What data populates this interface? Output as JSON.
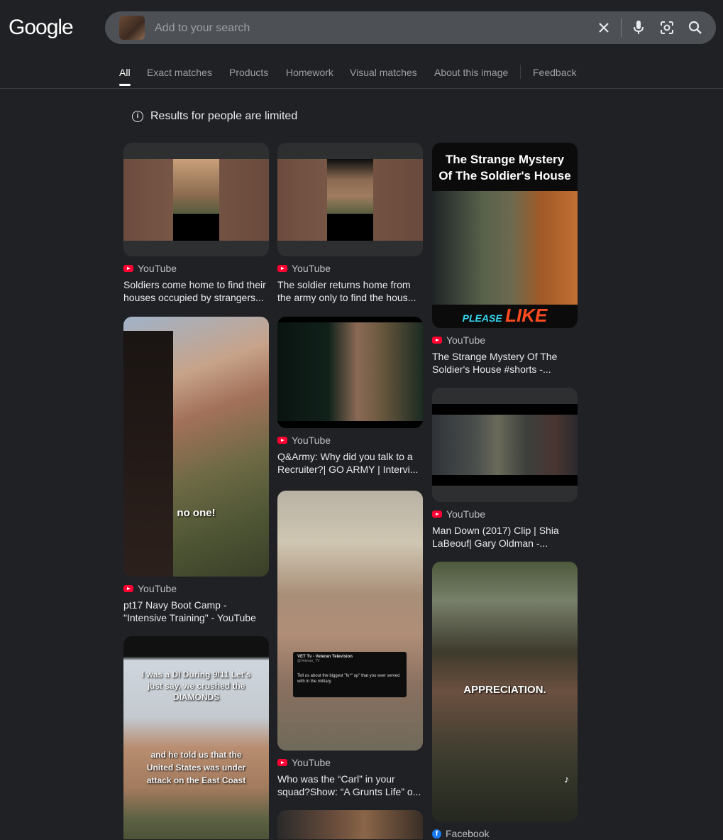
{
  "header": {
    "logo": "Google"
  },
  "search": {
    "placeholder": "Add to your search"
  },
  "tabs": [
    {
      "label": "All"
    },
    {
      "label": "Exact matches"
    },
    {
      "label": "Products"
    },
    {
      "label": "Homework"
    },
    {
      "label": "Visual matches"
    },
    {
      "label": "About this image"
    },
    {
      "label": "Feedback"
    }
  ],
  "notice": "Results for people are limited",
  "results": [
    {
      "source": "YouTube",
      "title": "Soldiers come home to find their houses occupied by strangers..."
    },
    {
      "source": "YouTube",
      "title": "The soldier returns home from the army only to find the hous..."
    },
    {
      "source": "YouTube",
      "title": "The Strange Mystery Of The Soldier's House #shorts -...",
      "overlay_top": "The Strange Mystery Of The Soldier's House",
      "overlay_bottom_a": "PLEASE",
      "overlay_bottom_b": "LIKE"
    },
    {
      "source": "YouTube",
      "title": "pt17 Navy Boot Camp - \"Intensive Training\" - YouTube",
      "overlay": "no one!"
    },
    {
      "source": "YouTube",
      "title": "Q&Army: Why did you talk to a Recruiter?| GO ARMY | Intervi..."
    },
    {
      "source": "YouTube",
      "title": "Man Down (2017) Clip | Shia LaBeouf| Gary Oldman -..."
    },
    {
      "source": "YouTube",
      "title": "Who was the “Carl” in your squad?Show: “A Grunts Life” o...",
      "overlay_head": "VET Tv - Veteran Television",
      "overlay_handle": "@Veteran_TV",
      "overlay_body": "Tell us about the biggest \"fu*\" up\" that you ever served with in the military."
    },
    {
      "source": "Facebook",
      "title": "",
      "overlay": "APPRECIATION."
    },
    {
      "source": "",
      "title": "",
      "overlay": "I was a DI During 9/11 Let's just say, we crushed the DIAMONDS",
      "overlay2": "and he told us that the United States was under attack on the East Coast"
    }
  ],
  "colors": {
    "background": "#202124",
    "youtube": "#ff0033",
    "facebook": "#1877f2",
    "like": "#ff4b1f",
    "please": "#35d7f0"
  }
}
